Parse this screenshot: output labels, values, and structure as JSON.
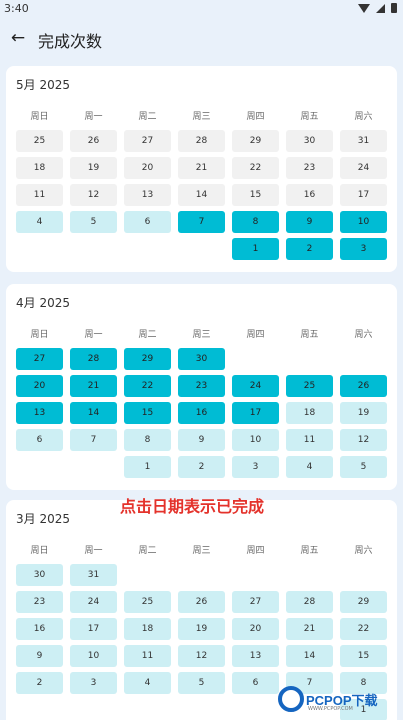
{
  "status": {
    "time": "3:40"
  },
  "header": {
    "title": "完成次数"
  },
  "weekdays": [
    "周日",
    "周一",
    "周二",
    "周三",
    "周四",
    "周五",
    "周六"
  ],
  "months": [
    {
      "title": "5月 2025",
      "weeks": [
        [
          {
            "d": "25",
            "s": "gray"
          },
          {
            "d": "26",
            "s": "gray"
          },
          {
            "d": "27",
            "s": "gray"
          },
          {
            "d": "28",
            "s": "gray"
          },
          {
            "d": "29",
            "s": "gray"
          },
          {
            "d": "30",
            "s": "gray"
          },
          {
            "d": "31",
            "s": "gray"
          }
        ],
        [
          {
            "d": "18",
            "s": "gray"
          },
          {
            "d": "19",
            "s": "gray"
          },
          {
            "d": "20",
            "s": "gray"
          },
          {
            "d": "21",
            "s": "gray"
          },
          {
            "d": "22",
            "s": "gray"
          },
          {
            "d": "23",
            "s": "gray"
          },
          {
            "d": "24",
            "s": "gray"
          }
        ],
        [
          {
            "d": "11",
            "s": "gray"
          },
          {
            "d": "12",
            "s": "gray"
          },
          {
            "d": "13",
            "s": "gray"
          },
          {
            "d": "14",
            "s": "gray"
          },
          {
            "d": "15",
            "s": "gray"
          },
          {
            "d": "16",
            "s": "gray"
          },
          {
            "d": "17",
            "s": "gray"
          }
        ],
        [
          {
            "d": "4",
            "s": "light"
          },
          {
            "d": "5",
            "s": "light"
          },
          {
            "d": "6",
            "s": "light"
          },
          {
            "d": "7",
            "s": "done"
          },
          {
            "d": "8",
            "s": "done"
          },
          {
            "d": "9",
            "s": "done"
          },
          {
            "d": "10",
            "s": "done"
          }
        ],
        [
          null,
          null,
          null,
          null,
          {
            "d": "1",
            "s": "done"
          },
          {
            "d": "2",
            "s": "done"
          },
          {
            "d": "3",
            "s": "done"
          }
        ]
      ]
    },
    {
      "title": "4月 2025",
      "weeks": [
        [
          {
            "d": "27",
            "s": "done"
          },
          {
            "d": "28",
            "s": "done"
          },
          {
            "d": "29",
            "s": "done"
          },
          {
            "d": "30",
            "s": "done"
          },
          null,
          null,
          null
        ],
        [
          {
            "d": "20",
            "s": "done"
          },
          {
            "d": "21",
            "s": "done"
          },
          {
            "d": "22",
            "s": "done"
          },
          {
            "d": "23",
            "s": "done"
          },
          {
            "d": "24",
            "s": "done"
          },
          {
            "d": "25",
            "s": "done"
          },
          {
            "d": "26",
            "s": "done"
          }
        ],
        [
          {
            "d": "13",
            "s": "done"
          },
          {
            "d": "14",
            "s": "done"
          },
          {
            "d": "15",
            "s": "done"
          },
          {
            "d": "16",
            "s": "done"
          },
          {
            "d": "17",
            "s": "done"
          },
          {
            "d": "18",
            "s": "light"
          },
          {
            "d": "19",
            "s": "light"
          }
        ],
        [
          {
            "d": "6",
            "s": "light"
          },
          {
            "d": "7",
            "s": "light"
          },
          {
            "d": "8",
            "s": "light"
          },
          {
            "d": "9",
            "s": "light"
          },
          {
            "d": "10",
            "s": "light"
          },
          {
            "d": "11",
            "s": "light"
          },
          {
            "d": "12",
            "s": "light"
          }
        ],
        [
          null,
          null,
          {
            "d": "1",
            "s": "light"
          },
          {
            "d": "2",
            "s": "light"
          },
          {
            "d": "3",
            "s": "light"
          },
          {
            "d": "4",
            "s": "light"
          },
          {
            "d": "5",
            "s": "light"
          }
        ]
      ]
    },
    {
      "title": "3月 2025",
      "weeks": [
        [
          {
            "d": "30",
            "s": "light"
          },
          {
            "d": "31",
            "s": "light"
          },
          null,
          null,
          null,
          null,
          null
        ],
        [
          {
            "d": "23",
            "s": "light"
          },
          {
            "d": "24",
            "s": "light"
          },
          {
            "d": "25",
            "s": "light"
          },
          {
            "d": "26",
            "s": "light"
          },
          {
            "d": "27",
            "s": "light"
          },
          {
            "d": "28",
            "s": "light"
          },
          {
            "d": "29",
            "s": "light"
          }
        ],
        [
          {
            "d": "16",
            "s": "light"
          },
          {
            "d": "17",
            "s": "light"
          },
          {
            "d": "18",
            "s": "light"
          },
          {
            "d": "19",
            "s": "light"
          },
          {
            "d": "20",
            "s": "light"
          },
          {
            "d": "21",
            "s": "light"
          },
          {
            "d": "22",
            "s": "light"
          }
        ],
        [
          {
            "d": "9",
            "s": "light"
          },
          {
            "d": "10",
            "s": "light"
          },
          {
            "d": "11",
            "s": "light"
          },
          {
            "d": "12",
            "s": "light"
          },
          {
            "d": "13",
            "s": "light"
          },
          {
            "d": "14",
            "s": "light"
          },
          {
            "d": "15",
            "s": "light"
          }
        ],
        [
          {
            "d": "2",
            "s": "light"
          },
          {
            "d": "3",
            "s": "light"
          },
          {
            "d": "4",
            "s": "light"
          },
          {
            "d": "5",
            "s": "light"
          },
          {
            "d": "6",
            "s": "light"
          },
          {
            "d": "7",
            "s": "light"
          },
          {
            "d": "8",
            "s": "light"
          }
        ],
        [
          null,
          null,
          null,
          null,
          null,
          null,
          {
            "d": "1",
            "s": "light"
          }
        ]
      ]
    }
  ],
  "annotation": {
    "text": "点击日期表示已完成"
  },
  "watermark": {
    "text": "PCPOP下载",
    "sub": "WWW.PCPOP.COM"
  },
  "colors": {
    "done": "#00bcd4",
    "light": "#cdeff4",
    "gray": "#f1f1f1",
    "annotation": "#e4322b"
  },
  "icons": {
    "back": "arrow-left-icon"
  }
}
